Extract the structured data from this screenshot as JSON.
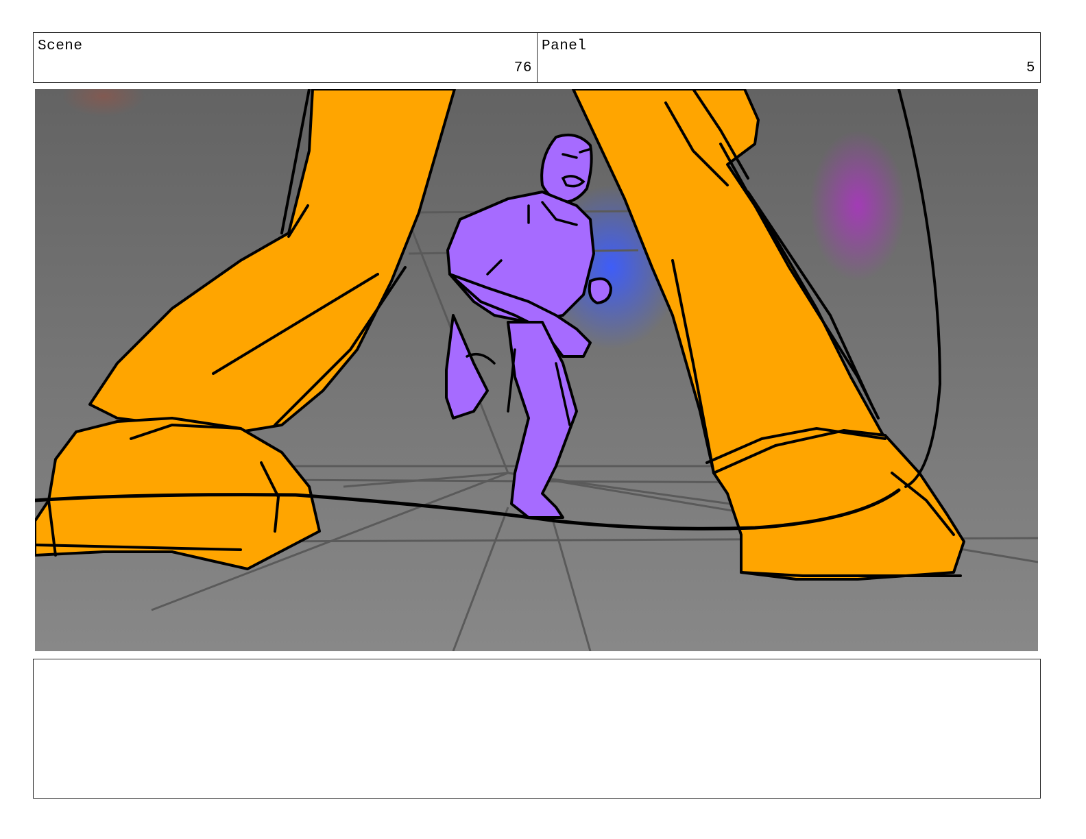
{
  "header": {
    "scene_label": "Scene",
    "scene_number": "76",
    "panel_label": "Panel",
    "panel_number": "5"
  },
  "colors": {
    "giant_fill": "#ffa500",
    "hero_fill": "#a66bff",
    "background": "#6e6e6e",
    "glow_blue": "#3c5cff",
    "glow_magenta": "#b030c8"
  }
}
